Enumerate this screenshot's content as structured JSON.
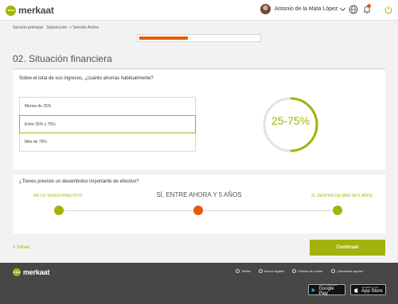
{
  "header": {
    "brand": "merkaat",
    "user_name": "Antonio de la Mata López"
  },
  "breadcrumb": [
    "Sección principal",
    "Subsección",
    "Sección Activa"
  ],
  "progress": {
    "segments": 2,
    "active_segment": 1,
    "fraction": 0.4
  },
  "section_title": "02. Situación financiera",
  "question1": {
    "text": "Sobre el total de sus ingresos, ¿cuánto ahorras habitualmente?",
    "options": [
      "Menos de 25%",
      "Entre 25% y 75%",
      "Más de 75%"
    ],
    "selected_index": 1,
    "gauge_value": "25-75%",
    "gauge_fraction": 0.5
  },
  "question2": {
    "text": "¿Tienes previsto un desembolso importante de efectivo?",
    "left_label": "NO LO TENGO PREVISTO",
    "center_label": "SÍ, ENTRE AHORA Y 5 AÑOS",
    "right_label": "SÍ, DENTRO DE MÁS DE 5 AÑOS",
    "selected": "center"
  },
  "nav": {
    "back_label": "< Volver",
    "continue_label": "Continuar"
  },
  "footer": {
    "brand": "merkaat",
    "links": [
      "Tarifas",
      "Avisos legales",
      "Política de cookie",
      "¿Necesitas ayuda?"
    ],
    "google_small": "DISPONIBLE EN",
    "google_large": "Google Play",
    "apple_small": "Available on the",
    "apple_large": "App Store"
  },
  "colors": {
    "accent": "#a3b20c",
    "highlight": "#e55a0b",
    "footer_bg": "#474747"
  }
}
